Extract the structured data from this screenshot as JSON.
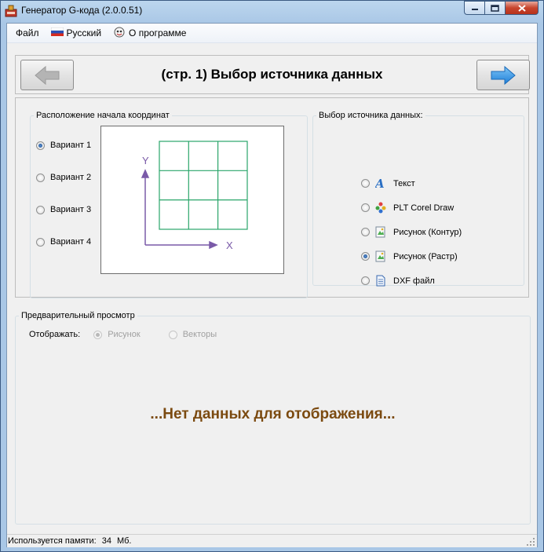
{
  "window": {
    "title": "Генератор G-кода (2.0.0.51)"
  },
  "menu": {
    "file": "Файл",
    "language": "Русский",
    "about": "О программе"
  },
  "header": {
    "title": "(стр. 1) Выбор источника данных"
  },
  "origin_group": {
    "legend": "Расположение начала координат",
    "options": [
      {
        "label": "Вариант 1",
        "checked": true
      },
      {
        "label": "Вариант 2",
        "checked": false
      },
      {
        "label": "Вариант 3",
        "checked": false
      },
      {
        "label": "Вариант 4",
        "checked": false
      }
    ],
    "axis_x": "X",
    "axis_y": "Y"
  },
  "source_group": {
    "legend": "Выбор источника данных:",
    "options": [
      {
        "label": "Текст",
        "icon": "text-icon",
        "checked": false
      },
      {
        "label": "PLT Corel Draw",
        "icon": "corel-icon",
        "checked": false
      },
      {
        "label": "Рисунок (Контур)",
        "icon": "image-contour-icon",
        "checked": false
      },
      {
        "label": "Рисунок (Растр)",
        "icon": "image-raster-icon",
        "checked": true
      },
      {
        "label": "DXF файл",
        "icon": "dxf-file-icon",
        "checked": false
      }
    ]
  },
  "preview": {
    "legend": "Предварительный просмотр",
    "show_label": "Отображать:",
    "mode_image": "Рисунок",
    "mode_vectors": "Векторы",
    "empty_message": "...Нет данных для отображения..."
  },
  "status": {
    "memory_label": "Используется памяти:",
    "memory_value": "34",
    "memory_unit": "Мб."
  },
  "colors": {
    "grid": "#2aa56a",
    "axis": "#7a5aa8",
    "empty_message": "#7b4a10",
    "next_arrow": "#3a95e0"
  }
}
